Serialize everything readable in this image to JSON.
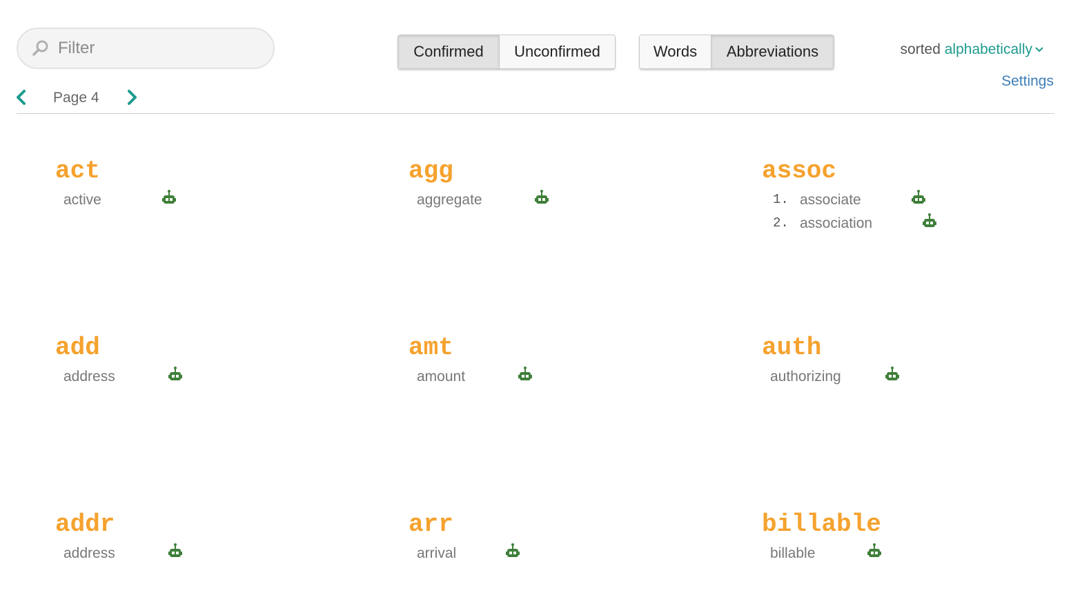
{
  "filter": {
    "placeholder": "Filter",
    "icon": "search-icon"
  },
  "status_toggle": {
    "confirmed": "Confirmed",
    "unconfirmed": "Unconfirmed",
    "active": "Confirmed"
  },
  "type_toggle": {
    "words": "Words",
    "abbreviations": "Abbreviations",
    "active": "Abbreviations"
  },
  "sort": {
    "prefix": "sorted",
    "value": "alphabetically"
  },
  "settings": "Settings",
  "pager": {
    "label": "Page 4"
  },
  "colors": {
    "abbreviation": "#f5a22e",
    "accent": "#1e9a8f",
    "robot": "#3f7f3a",
    "link": "#3d7fb8"
  },
  "entries": [
    {
      "abbr": "act",
      "meanings": [
        {
          "word": "active"
        }
      ]
    },
    {
      "abbr": "agg",
      "meanings": [
        {
          "word": "aggregate"
        }
      ]
    },
    {
      "abbr": "assoc",
      "meanings": [
        {
          "num": "1.",
          "word": "associate"
        },
        {
          "num": "2.",
          "word": "association"
        }
      ]
    },
    {
      "abbr": "add",
      "meanings": [
        {
          "word": "address"
        }
      ]
    },
    {
      "abbr": "amt",
      "meanings": [
        {
          "word": "amount"
        }
      ]
    },
    {
      "abbr": "auth",
      "meanings": [
        {
          "word": "authorizing"
        }
      ]
    },
    {
      "abbr": "addr",
      "meanings": [
        {
          "word": "address"
        }
      ]
    },
    {
      "abbr": "arr",
      "meanings": [
        {
          "word": "arrival"
        }
      ]
    },
    {
      "abbr": "billable",
      "meanings": [
        {
          "word": "billable"
        }
      ]
    }
  ]
}
